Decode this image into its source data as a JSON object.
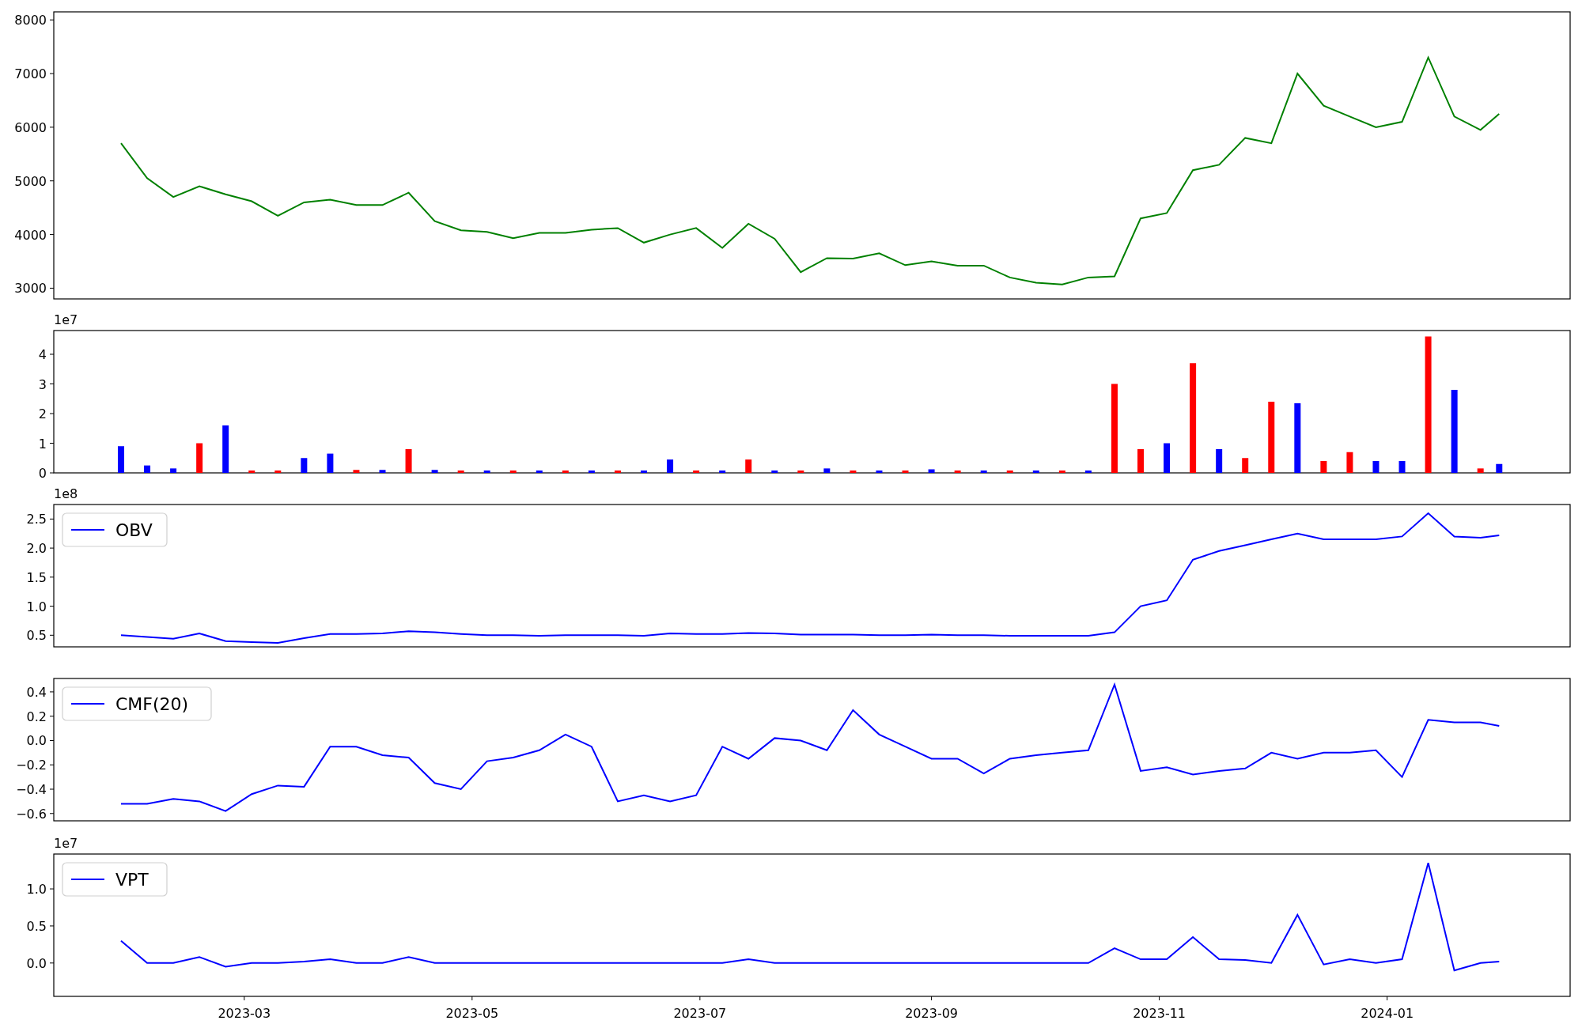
{
  "panels": [
    {
      "chart_data": {
        "type": "line",
        "x": [
          "2023-01-27",
          "2023-02-03",
          "2023-02-10",
          "2023-02-17",
          "2023-02-24",
          "2023-03-03",
          "2023-03-10",
          "2023-03-17",
          "2023-03-24",
          "2023-03-31",
          "2023-04-07",
          "2023-04-14",
          "2023-04-21",
          "2023-04-28",
          "2023-05-05",
          "2023-05-12",
          "2023-05-19",
          "2023-05-26",
          "2023-06-02",
          "2023-06-09",
          "2023-06-16",
          "2023-06-23",
          "2023-06-30",
          "2023-07-07",
          "2023-07-14",
          "2023-07-21",
          "2023-07-28",
          "2023-08-04",
          "2023-08-11",
          "2023-08-18",
          "2023-08-25",
          "2023-09-01",
          "2023-09-08",
          "2023-09-15",
          "2023-09-22",
          "2023-09-29",
          "2023-10-06",
          "2023-10-13",
          "2023-10-20",
          "2023-10-27",
          "2023-11-03",
          "2023-11-10",
          "2023-11-17",
          "2023-11-24",
          "2023-12-01",
          "2023-12-08",
          "2023-12-15",
          "2023-12-22",
          "2023-12-29",
          "2024-01-05",
          "2024-01-12",
          "2024-01-19",
          "2024-01-26",
          "2024-01-31"
        ],
        "series": [
          {
            "color": "#008000",
            "values": [
              5700,
              5050,
              4700,
              4900,
              4750,
              4620,
              4350,
              4600,
              4650,
              4550,
              4550,
              4780,
              4250,
              4080,
              4050,
              3930,
              4030,
              4030,
              4090,
              4120,
              3850,
              4000,
              4120,
              3750,
              4200,
              3920,
              3300,
              3560,
              3550,
              3650,
              3430,
              3500,
              3420,
              3420,
              3200,
              3100,
              3070,
              3200,
              3220,
              4300,
              4400,
              5200,
              5300,
              5800,
              5700,
              7000,
              6400,
              6200,
              6000,
              6100,
              7300,
              6200,
              5950,
              6250
            ]
          }
        ],
        "xlim": [
          "2023-01-09",
          "2024-02-19"
        ],
        "ylim": [
          2800,
          8150
        ],
        "yticks": [
          3000,
          4000,
          5000,
          6000,
          7000,
          8000
        ]
      }
    },
    {
      "offset_text": "1e7",
      "chart_data": {
        "type": "bar",
        "x": [
          "2023-01-27",
          "2023-02-03",
          "2023-02-10",
          "2023-02-17",
          "2023-02-24",
          "2023-03-03",
          "2023-03-10",
          "2023-03-17",
          "2023-03-24",
          "2023-03-31",
          "2023-04-07",
          "2023-04-14",
          "2023-04-21",
          "2023-04-28",
          "2023-05-05",
          "2023-05-12",
          "2023-05-19",
          "2023-05-26",
          "2023-06-02",
          "2023-06-09",
          "2023-06-16",
          "2023-06-23",
          "2023-06-30",
          "2023-07-07",
          "2023-07-14",
          "2023-07-21",
          "2023-07-28",
          "2023-08-04",
          "2023-08-11",
          "2023-08-18",
          "2023-08-25",
          "2023-09-01",
          "2023-09-08",
          "2023-09-15",
          "2023-09-22",
          "2023-09-29",
          "2023-10-06",
          "2023-10-13",
          "2023-10-20",
          "2023-10-27",
          "2023-11-03",
          "2023-11-10",
          "2023-11-17",
          "2023-11-24",
          "2023-12-01",
          "2023-12-08",
          "2023-12-15",
          "2023-12-22",
          "2023-12-29",
          "2024-01-05",
          "2024-01-12",
          "2024-01-19",
          "2024-01-26",
          "2024-01-31"
        ],
        "series": [
          {
            "color": "#ff0000",
            "values": [
              null,
              null,
              null,
              1.0,
              null,
              0.08,
              0.08,
              null,
              null,
              0.1,
              null,
              0.8,
              null,
              0.08,
              null,
              0.08,
              null,
              0.08,
              null,
              0.08,
              null,
              null,
              0.08,
              null,
              0.45,
              null,
              0.08,
              null,
              0.08,
              null,
              0.08,
              null,
              0.08,
              null,
              0.08,
              null,
              0.08,
              null,
              3.0,
              0.8,
              null,
              3.7,
              null,
              0.5,
              2.4,
              null,
              0.4,
              0.7,
              null,
              null,
              4.6,
              null,
              0.15,
              null
            ]
          },
          {
            "color": "#0000ff",
            "values": [
              0.9,
              0.25,
              0.15,
              null,
              1.6,
              null,
              null,
              0.5,
              0.65,
              null,
              0.1,
              null,
              0.1,
              null,
              0.08,
              null,
              0.08,
              null,
              0.08,
              null,
              0.08,
              0.45,
              null,
              0.08,
              null,
              0.08,
              null,
              0.15,
              null,
              0.08,
              null,
              0.12,
              null,
              0.08,
              null,
              0.08,
              null,
              0.08,
              null,
              null,
              1.0,
              null,
              0.8,
              null,
              null,
              2.35,
              null,
              null,
              0.4,
              0.4,
              null,
              2.8,
              null,
              0.3
            ]
          }
        ],
        "xlim": [
          "2023-01-09",
          "2024-02-19"
        ],
        "ylim": [
          0,
          4.8
        ],
        "yticks": [
          0,
          1,
          2,
          3,
          4
        ]
      }
    },
    {
      "offset_text": "1e8",
      "chart_data": {
        "type": "line",
        "x": [
          "2023-01-27",
          "2023-02-03",
          "2023-02-10",
          "2023-02-17",
          "2023-02-24",
          "2023-03-03",
          "2023-03-10",
          "2023-03-17",
          "2023-03-24",
          "2023-03-31",
          "2023-04-07",
          "2023-04-14",
          "2023-04-21",
          "2023-04-28",
          "2023-05-05",
          "2023-05-12",
          "2023-05-19",
          "2023-05-26",
          "2023-06-02",
          "2023-06-09",
          "2023-06-16",
          "2023-06-23",
          "2023-06-30",
          "2023-07-07",
          "2023-07-14",
          "2023-07-21",
          "2023-07-28",
          "2023-08-04",
          "2023-08-11",
          "2023-08-18",
          "2023-08-25",
          "2023-09-01",
          "2023-09-08",
          "2023-09-15",
          "2023-09-22",
          "2023-09-29",
          "2023-10-06",
          "2023-10-13",
          "2023-10-20",
          "2023-10-27",
          "2023-11-03",
          "2023-11-10",
          "2023-11-17",
          "2023-11-24",
          "2023-12-01",
          "2023-12-08",
          "2023-12-15",
          "2023-12-22",
          "2023-12-29",
          "2024-01-05",
          "2024-01-12",
          "2024-01-19",
          "2024-01-26",
          "2024-01-31"
        ],
        "series": [
          {
            "name": "OBV",
            "color": "#0000ff",
            "values": [
              0.5,
              0.47,
              0.44,
              0.53,
              0.4,
              0.38,
              0.37,
              0.45,
              0.52,
              0.52,
              0.53,
              0.57,
              0.55,
              0.52,
              0.5,
              0.5,
              0.49,
              0.5,
              0.5,
              0.5,
              0.49,
              0.53,
              0.52,
              0.52,
              0.54,
              0.53,
              0.51,
              0.51,
              0.51,
              0.5,
              0.5,
              0.51,
              0.5,
              0.5,
              0.49,
              0.49,
              0.49,
              0.49,
              0.55,
              1.0,
              1.1,
              1.8,
              1.95,
              2.05,
              2.15,
              2.25,
              2.15,
              2.15,
              2.15,
              2.2,
              2.6,
              2.2,
              2.18,
              2.22
            ]
          }
        ],
        "xlim": [
          "2023-01-09",
          "2024-02-19"
        ],
        "ylim": [
          0.3,
          2.75
        ],
        "yticks": [
          {
            "value": 0.5,
            "label": "0.5"
          },
          {
            "value": 1.0,
            "label": "1.0"
          },
          {
            "value": 1.5,
            "label": "1.5"
          },
          {
            "value": 2.0,
            "label": "2.0"
          },
          {
            "value": 2.5,
            "label": "2.5"
          }
        ]
      }
    },
    {
      "chart_data": {
        "type": "line",
        "x": [
          "2023-01-27",
          "2023-02-03",
          "2023-02-10",
          "2023-02-17",
          "2023-02-24",
          "2023-03-03",
          "2023-03-10",
          "2023-03-17",
          "2023-03-24",
          "2023-03-31",
          "2023-04-07",
          "2023-04-14",
          "2023-04-21",
          "2023-04-28",
          "2023-05-05",
          "2023-05-12",
          "2023-05-19",
          "2023-05-26",
          "2023-06-02",
          "2023-06-09",
          "2023-06-16",
          "2023-06-23",
          "2023-06-30",
          "2023-07-07",
          "2023-07-14",
          "2023-07-21",
          "2023-07-28",
          "2023-08-04",
          "2023-08-11",
          "2023-08-18",
          "2023-08-25",
          "2023-09-01",
          "2023-09-08",
          "2023-09-15",
          "2023-09-22",
          "2023-09-29",
          "2023-10-06",
          "2023-10-13",
          "2023-10-20",
          "2023-10-27",
          "2023-11-03",
          "2023-11-10",
          "2023-11-17",
          "2023-11-24",
          "2023-12-01",
          "2023-12-08",
          "2023-12-15",
          "2023-12-22",
          "2023-12-29",
          "2024-01-05",
          "2024-01-12",
          "2024-01-19",
          "2024-01-26",
          "2024-01-31"
        ],
        "series": [
          {
            "name": "CMF(20)",
            "color": "#0000ff",
            "values": [
              -0.52,
              -0.52,
              -0.48,
              -0.5,
              -0.58,
              -0.44,
              -0.37,
              -0.38,
              -0.05,
              -0.05,
              -0.12,
              -0.14,
              -0.35,
              -0.4,
              -0.17,
              -0.14,
              -0.08,
              0.05,
              -0.05,
              -0.5,
              -0.45,
              -0.5,
              -0.45,
              -0.05,
              -0.15,
              0.02,
              0.0,
              -0.08,
              0.25,
              0.05,
              -0.05,
              -0.15,
              -0.15,
              -0.27,
              -0.15,
              -0.12,
              -0.1,
              -0.08,
              0.46,
              -0.25,
              -0.22,
              -0.28,
              -0.25,
              -0.23,
              -0.1,
              -0.15,
              -0.1,
              -0.1,
              -0.08,
              -0.3,
              0.17,
              0.15,
              0.15,
              0.12
            ]
          }
        ],
        "xlim": [
          "2023-01-09",
          "2024-02-19"
        ],
        "ylim": [
          -0.66,
          0.51
        ],
        "yticks": [
          {
            "value": -0.6,
            "label": "−0.6"
          },
          {
            "value": -0.4,
            "label": "−0.4"
          },
          {
            "value": -0.2,
            "label": "−0.2"
          },
          {
            "value": 0,
            "label": "0.0"
          },
          {
            "value": 0.2,
            "label": "0.2"
          },
          {
            "value": 0.4,
            "label": "0.4"
          }
        ]
      }
    },
    {
      "offset_text": "1e7",
      "chart_data": {
        "type": "line",
        "x": [
          "2023-01-27",
          "2023-02-03",
          "2023-02-10",
          "2023-02-17",
          "2023-02-24",
          "2023-03-03",
          "2023-03-10",
          "2023-03-17",
          "2023-03-24",
          "2023-03-31",
          "2023-04-07",
          "2023-04-14",
          "2023-04-21",
          "2023-04-28",
          "2023-05-05",
          "2023-05-12",
          "2023-05-19",
          "2023-05-26",
          "2023-06-02",
          "2023-06-09",
          "2023-06-16",
          "2023-06-23",
          "2023-06-30",
          "2023-07-07",
          "2023-07-14",
          "2023-07-21",
          "2023-07-28",
          "2023-08-04",
          "2023-08-11",
          "2023-08-18",
          "2023-08-25",
          "2023-09-01",
          "2023-09-08",
          "2023-09-15",
          "2023-09-22",
          "2023-09-29",
          "2023-10-06",
          "2023-10-13",
          "2023-10-20",
          "2023-10-27",
          "2023-11-03",
          "2023-11-10",
          "2023-11-17",
          "2023-11-24",
          "2023-12-01",
          "2023-12-08",
          "2023-12-15",
          "2023-12-22",
          "2023-12-29",
          "2024-01-05",
          "2024-01-12",
          "2024-01-19",
          "2024-01-26",
          "2024-01-31"
        ],
        "series": [
          {
            "name": "VPT",
            "color": "#0000ff",
            "values": [
              0.3,
              0.0,
              0.0,
              0.08,
              -0.05,
              0.0,
              0.0,
              0.02,
              0.05,
              0.0,
              0.0,
              0.08,
              0.0,
              0.0,
              0.0,
              0.0,
              0.0,
              0.0,
              0.0,
              0.0,
              0.0,
              0.0,
              0.0,
              0.0,
              0.05,
              0.0,
              0.0,
              0.0,
              0.0,
              0.0,
              0.0,
              0.0,
              0.0,
              0.0,
              0.0,
              0.0,
              0.0,
              0.0,
              0.2,
              0.05,
              0.05,
              0.35,
              0.05,
              0.04,
              0.0,
              0.65,
              -0.02,
              0.05,
              0.0,
              0.05,
              1.35,
              -0.1,
              0.0,
              0.02
            ]
          }
        ],
        "xlim": [
          "2023-01-09",
          "2024-02-19"
        ],
        "ylim": [
          -0.45,
          1.47
        ],
        "yticks": [
          {
            "value": 0,
            "label": "0.0"
          },
          {
            "value": 0.5,
            "label": "0.5"
          },
          {
            "value": 1.0,
            "label": "1.0"
          }
        ],
        "xticks": [
          {
            "value": "2023-03-01",
            "label": "2023-03"
          },
          {
            "value": "2023-05-01",
            "label": "2023-05"
          },
          {
            "value": "2023-07-01",
            "label": "2023-07"
          },
          {
            "value": "2023-09-01",
            "label": "2023-09"
          },
          {
            "value": "2023-11-01",
            "label": "2023-11"
          },
          {
            "value": "2024-01-01",
            "label": "2024-01"
          }
        ]
      }
    }
  ]
}
